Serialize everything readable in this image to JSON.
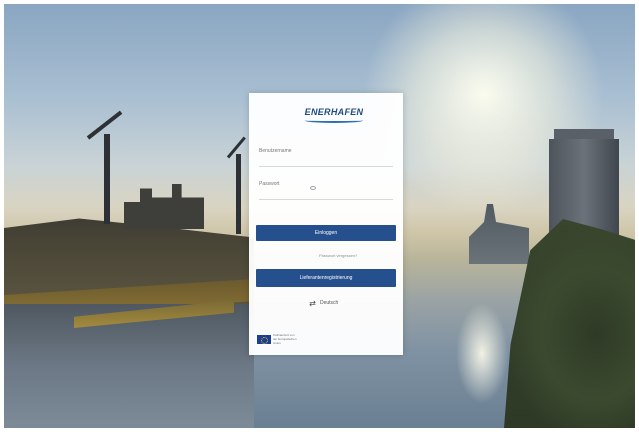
{
  "logo": {
    "text": "ENERHAFEN"
  },
  "login_form": {
    "username_label": "Benutzername",
    "username_value": "",
    "password_label": "Passwort",
    "password_value": "",
    "forgot_link": "Passwort vergessen?",
    "login_button": "Einloggen",
    "register_button": "Lieferantenregistrierung"
  },
  "language": {
    "label": "Deutsch",
    "icon": "translate-icon"
  },
  "eu_badge": {
    "text": "Kofinanziert von der Europäischen Union",
    "icon": "eu-flag-icon"
  },
  "colors": {
    "primary_button": "#254f8d",
    "logo": "#234b82",
    "card": "#ffffff"
  }
}
